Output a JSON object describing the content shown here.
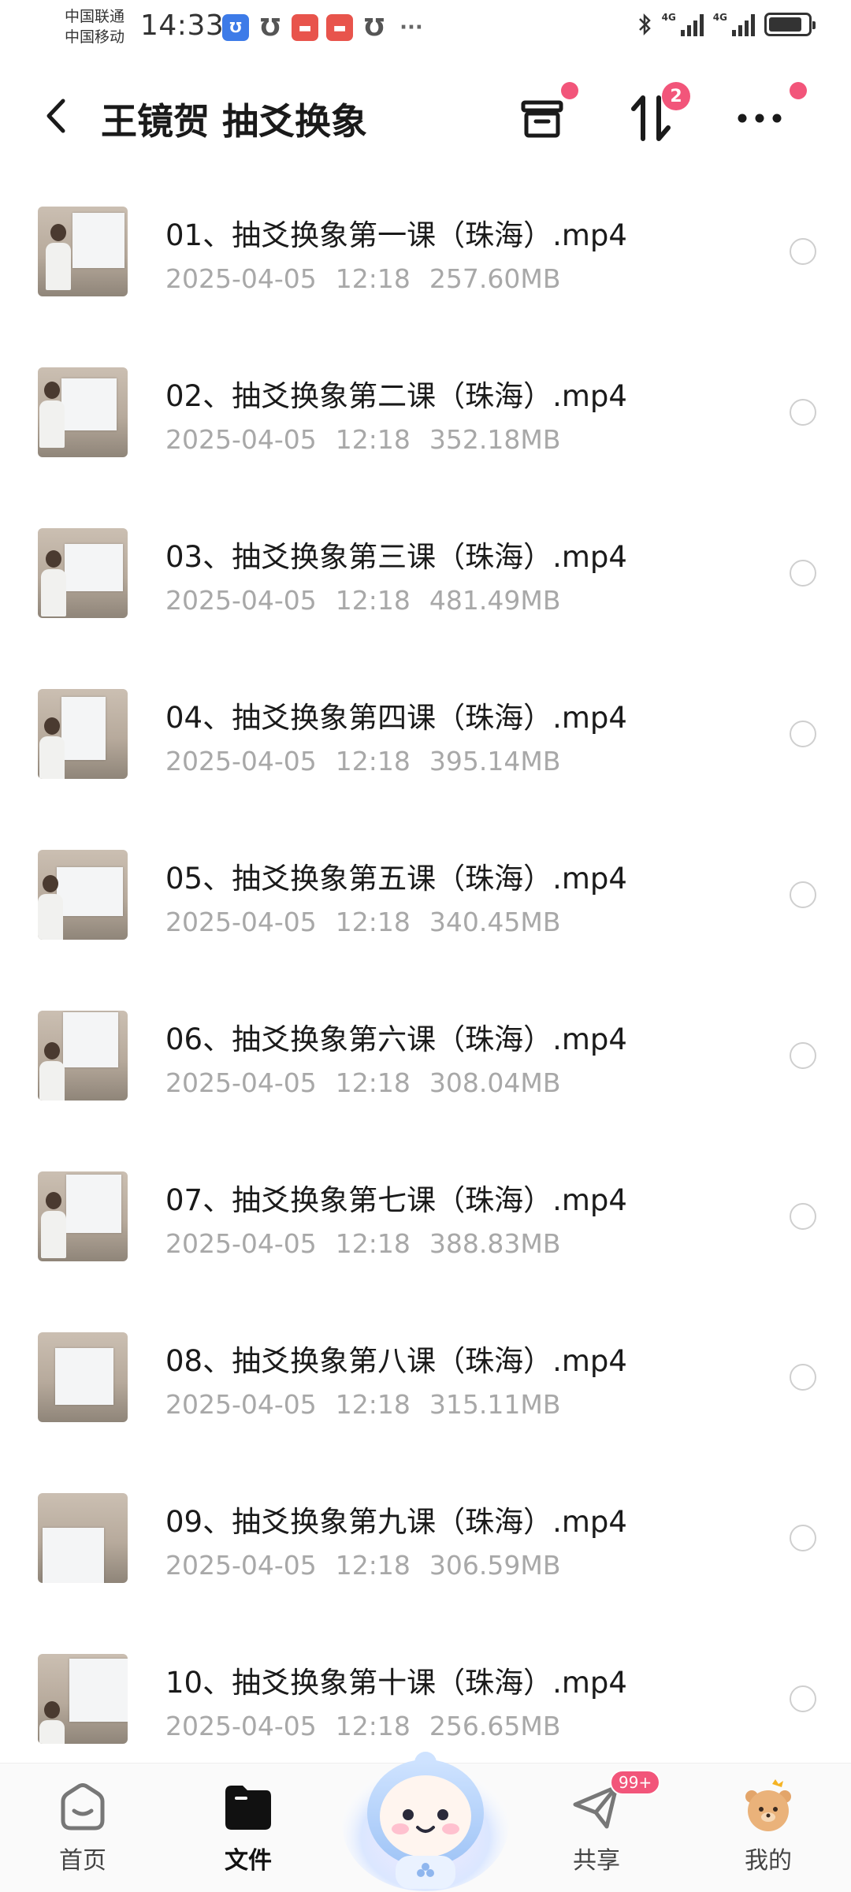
{
  "status_bar": {
    "carrier_1": "中国联通",
    "carrier_2": "中国移动",
    "time": "14:33",
    "more_notifications": "···",
    "net_1": "4G",
    "net_2": "4G",
    "battery_level": 0.85
  },
  "header": {
    "title": "王镜贺 抽爻换象",
    "transfer_badge": "2"
  },
  "files": [
    {
      "name": "01、抽爻换象第一课（珠海）.mp4",
      "date": "2025-04-05",
      "time": "12:18",
      "size": "257.60MB"
    },
    {
      "name": "02、抽爻换象第二课（珠海）.mp4",
      "date": "2025-04-05",
      "time": "12:18",
      "size": "352.18MB"
    },
    {
      "name": "03、抽爻换象第三课（珠海）.mp4",
      "date": "2025-04-05",
      "time": "12:18",
      "size": "481.49MB"
    },
    {
      "name": "04、抽爻换象第四课（珠海）.mp4",
      "date": "2025-04-05",
      "time": "12:18",
      "size": "395.14MB"
    },
    {
      "name": "05、抽爻换象第五课（珠海）.mp4",
      "date": "2025-04-05",
      "time": "12:18",
      "size": "340.45MB"
    },
    {
      "name": "06、抽爻换象第六课（珠海）.mp4",
      "date": "2025-04-05",
      "time": "12:18",
      "size": "308.04MB"
    },
    {
      "name": "07、抽爻换象第七课（珠海）.mp4",
      "date": "2025-04-05",
      "time": "12:18",
      "size": "388.83MB"
    },
    {
      "name": "08、抽爻换象第八课（珠海）.mp4",
      "date": "2025-04-05",
      "time": "12:18",
      "size": "315.11MB"
    },
    {
      "name": "09、抽爻换象第九课（珠海）.mp4",
      "date": "2025-04-05",
      "time": "12:18",
      "size": "306.59MB"
    },
    {
      "name": "10、抽爻换象第十课（珠海）.mp4",
      "date": "2025-04-05",
      "time": "12:18",
      "size": "256.65MB"
    }
  ],
  "bottom_nav": {
    "home": "首页",
    "files": "文件",
    "share": "共享",
    "share_badge": "99+",
    "me": "我的"
  },
  "colors": {
    "accent_pink": "#f2557a",
    "meta_gray": "#a8a8a8"
  }
}
